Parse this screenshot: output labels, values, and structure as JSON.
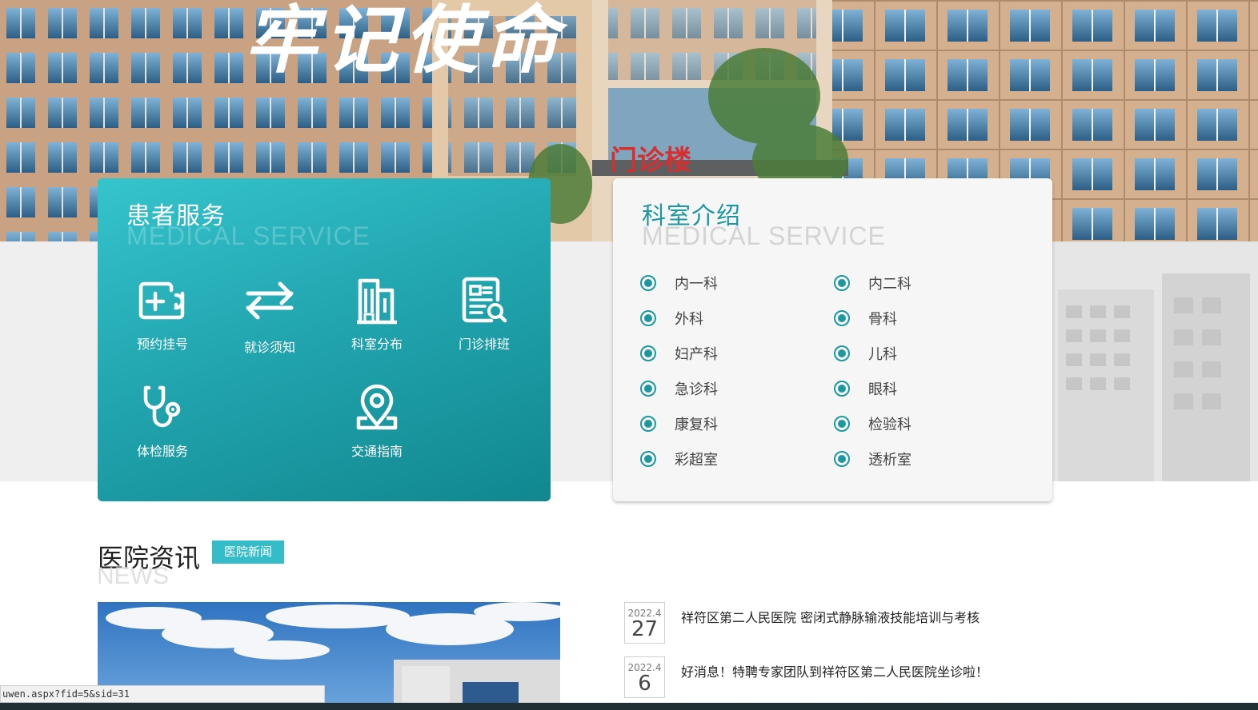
{
  "hero": {
    "slogan": "牢记使命",
    "building_sign": "门诊楼"
  },
  "patient_service": {
    "title": "患者服务",
    "subtitle": "MEDICAL SERVICE",
    "items": [
      {
        "label": "预约挂号",
        "icon": "calendar-plus-icon"
      },
      {
        "label": "就诊须知",
        "icon": "swap-arrows-icon"
      },
      {
        "label": "科室分布",
        "icon": "building-icon"
      },
      {
        "label": "门诊排班",
        "icon": "schedule-search-icon"
      },
      {
        "label": "体检服务",
        "icon": "stethoscope-icon"
      },
      {
        "label": "交通指南",
        "icon": "map-pin-icon"
      }
    ]
  },
  "departments": {
    "title": "科室介绍",
    "subtitle": "MEDICAL SERVICE",
    "items": [
      "内一科",
      "内二科",
      "外科",
      "骨科",
      "妇产科",
      "儿科",
      "急诊科",
      "眼科",
      "康复科",
      "检验科",
      "彩超室",
      "透析室"
    ]
  },
  "news": {
    "title": "医院资讯",
    "subtitle": "NEWS",
    "tag": "医院新闻",
    "items": [
      {
        "ym": "2022.4",
        "day": "27",
        "text": "祥符区第二人民医院 密闭式静脉输液技能培训与考核"
      },
      {
        "ym": "2022.4",
        "day": "6",
        "text": "好消息！特聘专家团队到祥符区第二人民医院坐诊啦！"
      }
    ]
  },
  "status_bar": {
    "url": "uwen.aspx?fid=5&sid=31"
  },
  "colors": {
    "teal": "#1d98a1",
    "panel_gradient_start": "#36c4cd",
    "panel_gradient_end": "#11878f",
    "tag": "#34bcc8"
  }
}
